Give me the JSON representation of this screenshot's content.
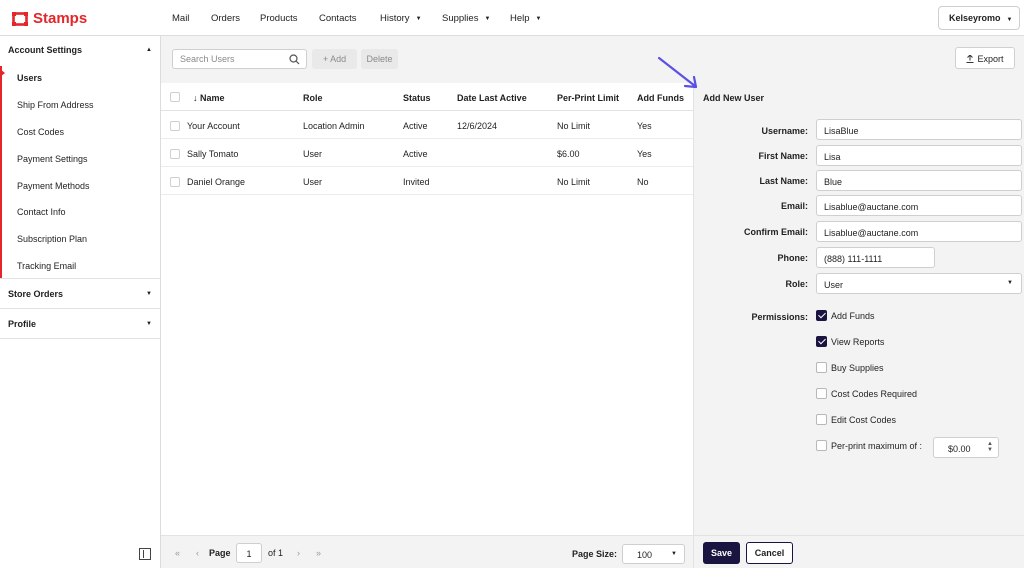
{
  "brand": {
    "name": "Stamps",
    "color": "#e4262a"
  },
  "nav": {
    "items": [
      {
        "label": "Mail"
      },
      {
        "label": "Orders"
      },
      {
        "label": "Products"
      },
      {
        "label": "Contacts"
      },
      {
        "label": "History"
      },
      {
        "label": "Supplies"
      },
      {
        "label": "Help"
      }
    ],
    "user": "Kelseyromo"
  },
  "sidebar": {
    "account_settings": "Account Settings",
    "items": [
      {
        "label": "Users"
      },
      {
        "label": "Ship From Address"
      },
      {
        "label": "Cost Codes"
      },
      {
        "label": "Payment Settings"
      },
      {
        "label": "Payment Methods"
      },
      {
        "label": "Contact Info"
      },
      {
        "label": "Subscription Plan"
      },
      {
        "label": "Tracking Email"
      }
    ],
    "store_orders": "Store Orders",
    "profile": "Profile"
  },
  "toolbar": {
    "search_placeholder": "Search Users",
    "add_label": "+ Add",
    "delete_label": "Delete",
    "export_label": "Export"
  },
  "table": {
    "columns": [
      "↓ Name",
      "Role",
      "Status",
      "Date Last Active",
      "Per-Print Limit",
      "Add Funds"
    ],
    "rows": [
      [
        "Your Account",
        "Location Admin",
        "Active",
        "12/6/2024",
        "No Limit",
        "Yes"
      ],
      [
        "Sally Tomato",
        "User",
        "Active",
        "",
        "$6.00",
        "Yes"
      ],
      [
        "Daniel Orange",
        "User",
        "Invited",
        "",
        "No Limit",
        "No"
      ]
    ]
  },
  "pagination": {
    "page_label": "Page",
    "page_value": "1",
    "of_label": "of 1",
    "page_size_label": "Page Size:",
    "page_size_value": "100"
  },
  "form": {
    "title": "Add New User",
    "fields": {
      "username": {
        "label": "Username:",
        "value": "LisaBlue"
      },
      "first_name": {
        "label": "First Name:",
        "value": "Lisa"
      },
      "last_name": {
        "label": "Last Name:",
        "value": "Blue"
      },
      "email": {
        "label": "Email:",
        "value": "Lisablue@auctane.com"
      },
      "confirm_email": {
        "label": "Confirm Email:",
        "value": "Lisablue@auctane.com"
      },
      "phone": {
        "label": "Phone:",
        "value": "(888) 111-1111"
      },
      "role": {
        "label": "Role:",
        "value": "User"
      }
    },
    "permissions_label": "Permissions:",
    "permissions": [
      {
        "label": "Add Funds",
        "checked": true
      },
      {
        "label": "View Reports",
        "checked": true
      },
      {
        "label": "Buy Supplies",
        "checked": false
      },
      {
        "label": "Cost Codes Required",
        "checked": false
      },
      {
        "label": "Edit Cost Codes",
        "checked": false
      },
      {
        "label": "Per-print maximum of :",
        "checked": false
      }
    ],
    "per_print_max": "$0.00",
    "save_label": "Save",
    "cancel_label": "Cancel",
    "accent_color": "#1a1440"
  },
  "annotation_color": "#5b50e6"
}
